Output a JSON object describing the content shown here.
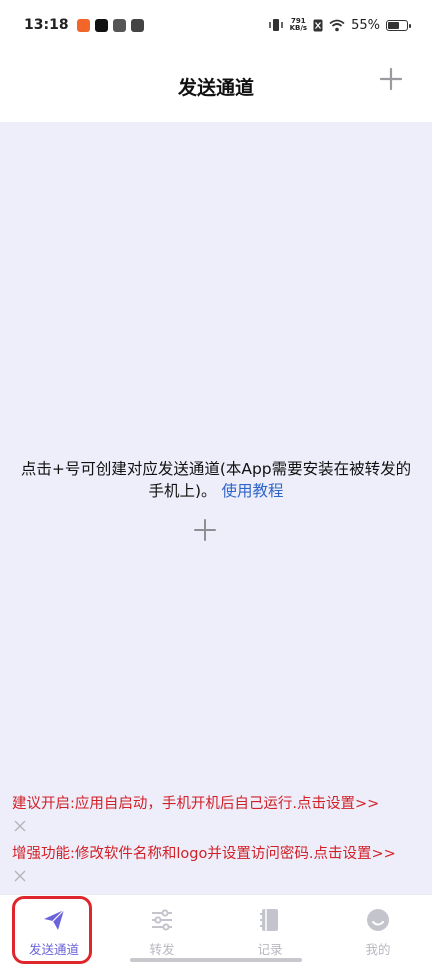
{
  "status_bar": {
    "time": "13:18",
    "speed_value": "791",
    "speed_unit": "KB/s",
    "battery_percent": "55%",
    "battery_level": 0.55
  },
  "header": {
    "title": "发送通道"
  },
  "main": {
    "empty_text": "点击+号可创建对应发送通道(本App需要安装在被转发的手机上)。",
    "tutorial_link": "使用教程"
  },
  "tips": [
    {
      "text": "建议开启:应用自启动，手机开机后自己运行.点击设置>>"
    },
    {
      "text": "增强功能:修改软件名称和logo并设置访问密码.点击设置>>"
    }
  ],
  "nav": {
    "items": [
      {
        "label": "发送通道",
        "icon": "send-icon",
        "active": true
      },
      {
        "label": "转发",
        "icon": "sliders-icon",
        "active": false
      },
      {
        "label": "记录",
        "icon": "notebook-icon",
        "active": false
      },
      {
        "label": "我的",
        "icon": "profile-icon",
        "active": false
      }
    ]
  },
  "colors": {
    "accent": "#6a63d9",
    "tip_red": "#d11f26",
    "link_blue": "#2f66c8",
    "background": "#eeeefa"
  }
}
